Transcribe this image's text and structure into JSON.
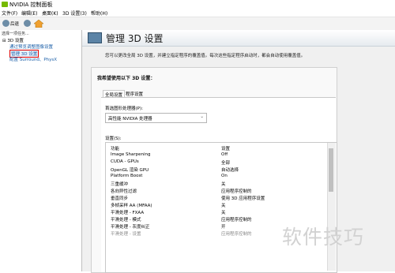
{
  "window": {
    "title": "NVIDIA 控制面板"
  },
  "menu": [
    "文件(F)",
    "编辑(E)",
    "桌面(K)",
    "3D 设置(3)",
    "帮助(H)"
  ],
  "toolbar": {
    "back": "后退",
    "forward": "▸"
  },
  "left_pane": {
    "task_label": "选择一项任务...",
    "tree": {
      "group": "3D 设置",
      "items": [
        {
          "label": "通过预览调整图像设置"
        },
        {
          "label": "管理 3D 设置",
          "selected": true
        },
        {
          "label": "配置 Surround、PhysX"
        }
      ]
    }
  },
  "page": {
    "title": "管理 3D 设置",
    "description": "您可以更改全局 3D 设置，并建立指定程序的覆盖值。每次这些指定程序启动时，都会自动使用覆盖值。",
    "section_title": "我希望使用以下 3D 设置：",
    "tabs": [
      {
        "label": "全局设置",
        "active": true
      },
      {
        "label": "程序设置",
        "active": false
      }
    ],
    "preferred_gpu_label": "首选图形处理器(P):",
    "preferred_gpu_value": "高性能 NVIDIA 处理器",
    "settings_label": "设置(S):",
    "table_headers": {
      "feature": "功能",
      "setting": "设置"
    },
    "rows": [
      {
        "k": "Image Sharpening",
        "v": "Off"
      },
      {
        "k": "CUDA - GPUs",
        "v": "全部"
      },
      {
        "k": "OpenGL 渲染 GPU",
        "v": "自动选择"
      },
      {
        "k": "Platform Boost",
        "v": "On"
      },
      {
        "k": "三重缓冲",
        "v": "关"
      },
      {
        "k": "各向异性过滤",
        "v": "应用程序控制的"
      },
      {
        "k": "垂直同步",
        "v": "使用 3D 应用程序设置"
      },
      {
        "k": "多帧采样 AA (MFAA)",
        "v": "关"
      },
      {
        "k": "平滑处理 - FXAA",
        "v": "关"
      },
      {
        "k": "平滑处理 - 模式",
        "v": "应用程序控制的"
      },
      {
        "k": "平滑处理 - 灰度纠正",
        "v": "开"
      },
      {
        "k": "平滑处理 - 设置",
        "v": "应用程序控制的"
      }
    ]
  },
  "watermark": "软件技巧",
  "colors": {
    "nvidia_green": "#76b900",
    "selection_red": "#e00000"
  }
}
